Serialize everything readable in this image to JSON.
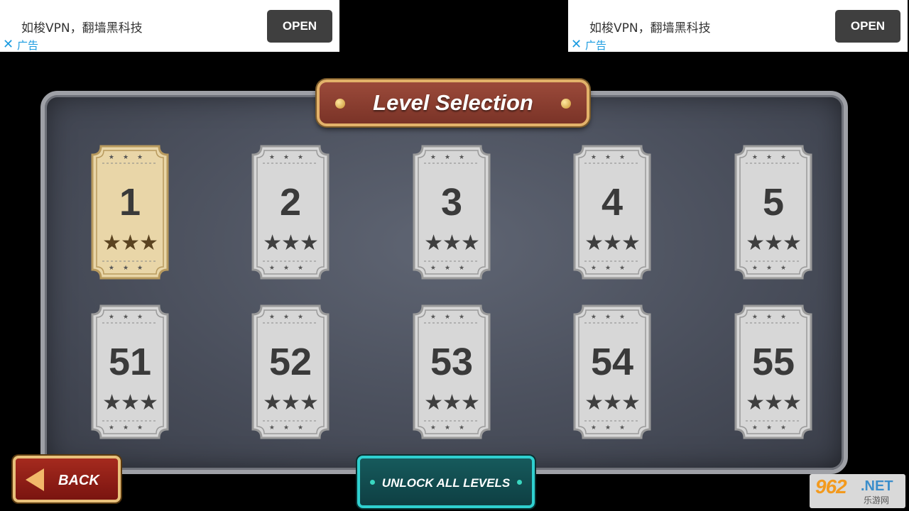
{
  "ads": [
    {
      "title": "如梭VPN，翻墙黑科技",
      "button": "OPEN",
      "close": "✕",
      "tag": "广告"
    },
    {
      "title": "如梭VPN，翻墙黑科技",
      "button": "OPEN",
      "close": "✕",
      "tag": "广告"
    }
  ],
  "title": "Level Selection",
  "levels": [
    {
      "number": "1",
      "stars": "★★★",
      "selected": true
    },
    {
      "number": "2",
      "stars": "★★★",
      "selected": false
    },
    {
      "number": "3",
      "stars": "★★★",
      "selected": false
    },
    {
      "number": "4",
      "stars": "★★★",
      "selected": false
    },
    {
      "number": "5",
      "stars": "★★★",
      "selected": false
    },
    {
      "number": "51",
      "stars": "★★★",
      "selected": false
    },
    {
      "number": "52",
      "stars": "★★★",
      "selected": false
    },
    {
      "number": "53",
      "stars": "★★★",
      "selected": false
    },
    {
      "number": "54",
      "stars": "★★★",
      "selected": false
    },
    {
      "number": "55",
      "stars": "★★★",
      "selected": false
    }
  ],
  "back_label": "BACK",
  "unlock_label": "UNLOCK ALL LEVELS",
  "watermark": {
    "main": "962",
    "net": ".NET",
    "sub": "乐游网"
  },
  "colors": {
    "ticket_selected": "#e9d6a8",
    "ticket_normal": "#d7d7d7",
    "star": "#3f3f3f",
    "star_selected": "#5a4320"
  }
}
